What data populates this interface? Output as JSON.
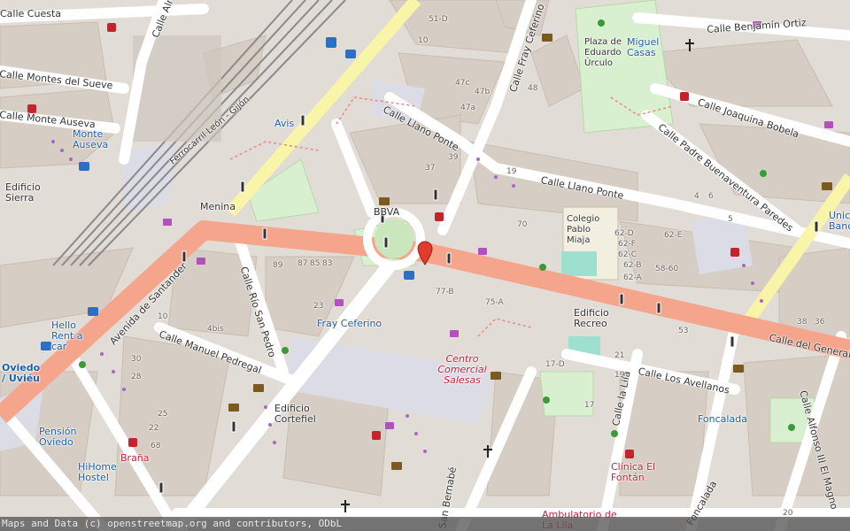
{
  "attribution": "Maps and Data (c) openstreetmap.org and contributors, ODbL",
  "colors": {
    "background": "#e2dcd6",
    "block": "#d9d0c9",
    "building": "#d4c8bd",
    "road": "#ffffff",
    "primary_road": "#f6a58d",
    "secondary_road": "#f8f4a8",
    "park": "#d8f0cf",
    "pedestrian": "#dcdce6",
    "rail": "#8a8a8a",
    "marker": "#e03b2b",
    "poi_text": "#1a5fa8",
    "mall_text": "#c7203a"
  },
  "streets": [
    "Calle Cuesta",
    "Calle Almacenes",
    "Calle Montes del Sueve",
    "Calle Monte Auseva",
    "Calle Llano Ponte",
    "Calle Fray Ceferino",
    "Calle Benjamín Ortiz",
    "Calle Joaquina Bobela",
    "Calle Padre Buenaventura Paredes",
    "Avenida de Santander",
    "Calle Río San Pedro",
    "Calle Manuel Pedregal",
    "Calle del General",
    "Calle Los Avellanos",
    "Calle la Lila",
    "Calle Alfonso III El Magno",
    "Foncalada",
    "San Bernabé",
    "Ferrocarril León - Gijón"
  ],
  "places": {
    "plaza": "Plaza de Eduardo Úrculo",
    "miguel_casas": "Miguel Casas",
    "monte_auseva": "Monte Auseva",
    "edificio_sierra": "Edificio Sierra",
    "avis": "Avis",
    "menina": "Menina",
    "bbva": "BBVA",
    "colegio": "Colegio Pablo Miaja",
    "edificio_recreo": "Edificio Recreo",
    "fray_ceferino": "Fray Ceferino",
    "hello_rent": "Hello Rent a car",
    "oviedo": "Oviedo / Uviéu",
    "pension": "Pensión Oviedo",
    "brana": "Braña",
    "hihome": "HiHome Hostel",
    "edificio_cortefiel": "Edificio Cortefiel",
    "centro_comercial": "Centro Comercial Salesas",
    "clinica": "Clínica El Fontán",
    "foncalada_stop": "Foncalada",
    "ambulatorio": "Ambulatorio de La Lila",
    "unicaja": "Unicaja Banco"
  },
  "house_numbers": [
    "51-D",
    "10",
    "47c",
    "47b",
    "47a",
    "48",
    "37",
    "39",
    "19",
    "70",
    "62-D",
    "62-E",
    "62-F",
    "62-C",
    "62-B",
    "58-60",
    "62-A",
    "89",
    "87",
    "85",
    "83",
    "23",
    "77-B",
    "75-A",
    "10",
    "4bis",
    "30",
    "28",
    "25",
    "22",
    "68",
    "17-D",
    "21",
    "19",
    "17",
    "53",
    "38",
    "36",
    "5",
    "6",
    "4",
    "20"
  ]
}
